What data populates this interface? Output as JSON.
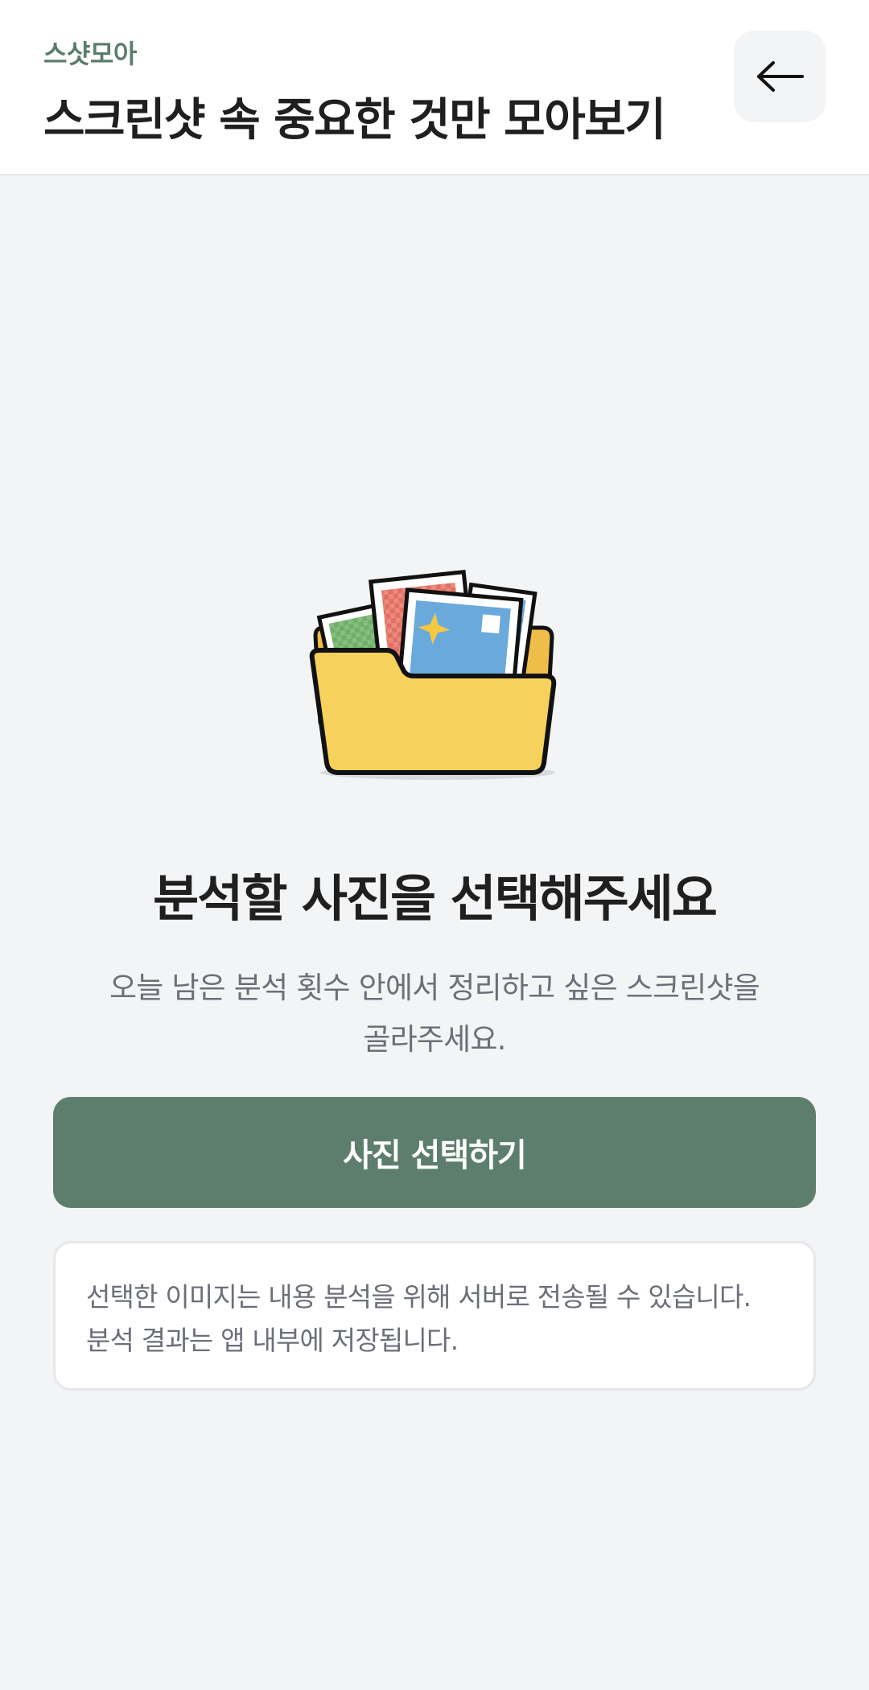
{
  "header": {
    "app_name": "스샷모아",
    "title": "스크린샷 속 중요한 것만 모아보기",
    "back_icon": "arrow-left-icon"
  },
  "illustration": {
    "icon": "folder-with-photos-icon",
    "colors": {
      "folder": "#f6d25c",
      "folder_back": "#eebd4a",
      "photo_green": "#6fae6b",
      "photo_red": "#e07063",
      "photo_blue": "#69a9db",
      "sparkle": "#f5c842",
      "outline": "#111111"
    }
  },
  "empty_state": {
    "title": "분석할 사진을 선택해주세요",
    "description_line1": "오늘 남은 분석 횟수 안에서 정리하고 싶은 스크린샷을",
    "description_line2": "골라주세요."
  },
  "actions": {
    "select_photos_label": "사진 선택하기"
  },
  "notice": {
    "line1": "선택한 이미지는 내용 분석을 위해 서버로 전송될 수 있습니다.",
    "line2": "분석 결과는 앱 내부에 저장됩니다."
  },
  "colors": {
    "brand": "#5d7e6d",
    "background": "#f3f4f6",
    "title_text": "#1f1f1f",
    "secondary_text": "#6b6f78"
  }
}
